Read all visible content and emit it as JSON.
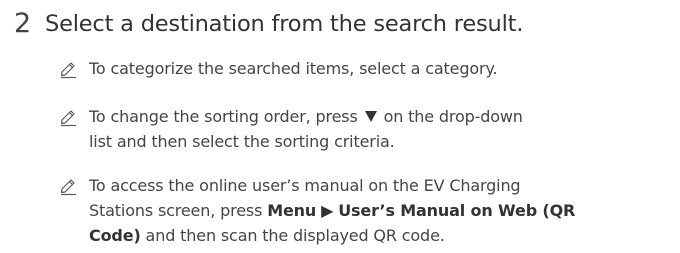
{
  "step": {
    "number": "2",
    "title": "Select a destination from the search result."
  },
  "notes": [
    {
      "icon": "pencil-note-icon",
      "text": "To categorize the searched items, select a category."
    },
    {
      "icon": "pencil-note-icon",
      "text_before": "To change the sorting order, press",
      "symbol": "▼",
      "text_after": "on the drop-down",
      "text_line2": "list and then select the sorting criteria."
    },
    {
      "icon": "pencil-note-icon",
      "line1": "To access the online user’s manual on the EV Charging",
      "line2_prefix": "Stations screen, press",
      "menu": "Menu",
      "arrow": "▶",
      "menu_item": "User’s Manual on Web (QR",
      "menu_item_cont": "Code)",
      "line3_suffix": "and then scan the displayed QR code."
    }
  ]
}
